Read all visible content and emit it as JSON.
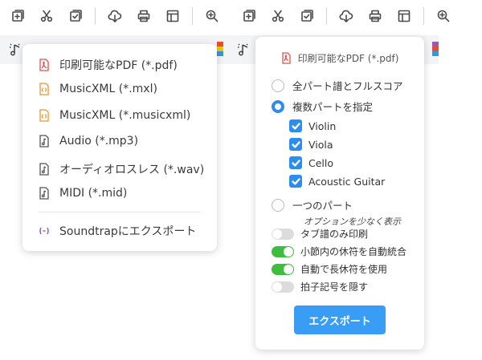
{
  "toolbar_icons": [
    "add-page-icon",
    "scissors-icon",
    "checklist-icon",
    "cloud-download-icon",
    "print-icon",
    "layout-icon",
    "zoom-in-icon"
  ],
  "colors": {
    "accent": "#2d8cf0",
    "toggle_on": "#3ebd3e",
    "pdf_icon": "#d9534f",
    "xml_icon": "#e8962e",
    "soundtrap_icon": "#8e44ad"
  },
  "export_menu": {
    "items": [
      {
        "label": "印刷可能なPDF (*.pdf)",
        "icon": "pdf-file-icon"
      },
      {
        "label": "MusicXML (*.mxl)",
        "icon": "xml-file-icon"
      },
      {
        "label": "MusicXML (*.musicxml)",
        "icon": "xml-file-icon"
      },
      {
        "label": "Audio (*.mp3)",
        "icon": "audio-file-icon"
      },
      {
        "label": "オーディオロスレス (*.wav)",
        "icon": "audio-file-icon"
      },
      {
        "label": "MIDI (*.mid)",
        "icon": "midi-file-icon"
      }
    ],
    "soundtrap": {
      "label": "Soundtrapにエクスポート",
      "icon": "soundtrap-icon"
    }
  },
  "pdf_panel": {
    "title": "印刷可能なPDF (*.pdf)",
    "options": {
      "all_parts": "全パート譜とフルスコア",
      "multiple_parts": "複数パートを指定",
      "single_part": "一つのパート"
    },
    "selected_option": "multiple_parts",
    "parts": [
      {
        "name": "Violin",
        "checked": true
      },
      {
        "name": "Viola",
        "checked": true
      },
      {
        "name": "Cello",
        "checked": true
      },
      {
        "name": "Acoustic Guitar",
        "checked": true
      }
    ],
    "fewer_options_link": "オプションを少なく表示",
    "toggles": [
      {
        "label": "タブ譜のみ印刷",
        "on": false
      },
      {
        "label": "小節内の休符を自動統合",
        "on": true
      },
      {
        "label": "自動で長休符を使用",
        "on": true
      },
      {
        "label": "拍子記号を隠す",
        "on": false
      }
    ],
    "export_button": "エクスポート"
  }
}
